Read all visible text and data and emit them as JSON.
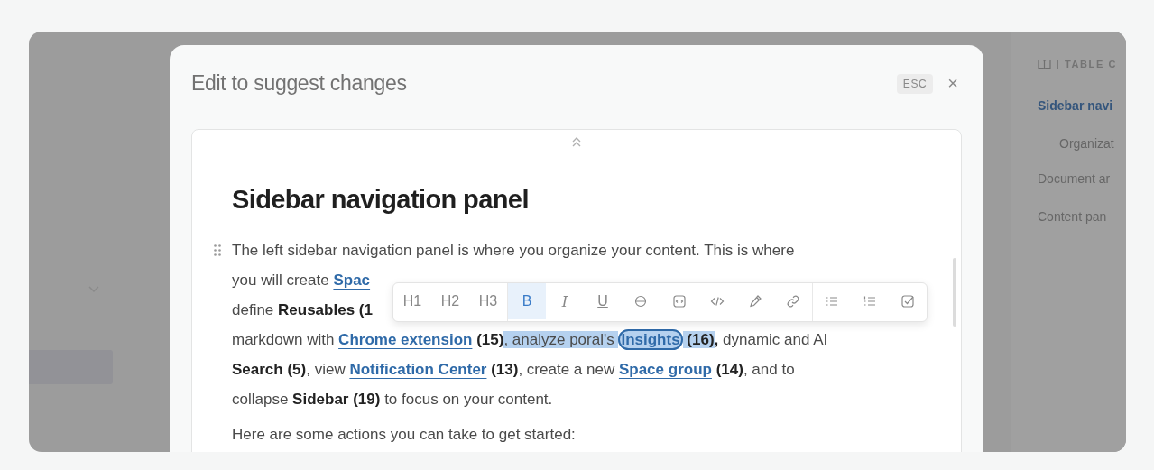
{
  "background_page": {
    "toc": {
      "heading": "TABLE C",
      "items": [
        {
          "label": "Sidebar navi",
          "selected": true,
          "children": [
            {
              "label": "Organizat",
              "selected": false
            }
          ]
        },
        {
          "label": "Document ar",
          "selected": false
        },
        {
          "label": "Content pan",
          "selected": false
        }
      ]
    }
  },
  "modal": {
    "title": "Edit to suggest changes",
    "shortcut": "ESC",
    "close": "×",
    "editor": {
      "heading": "Sidebar navigation panel",
      "paragraphs": [
        {
          "lines": [
            [
              {
                "kind": "text",
                "text": "The left sidebar navigation panel is where you organize your content. This is where",
                "selected": false
              }
            ],
            [
              {
                "kind": "text",
                "text": "you will create ",
                "selected": false
              },
              {
                "kind": "link",
                "text": "Spac",
                "selected": false
              }
            ],
            [
              {
                "kind": "text",
                "text": "define ",
                "selected": false
              },
              {
                "kind": "bold",
                "text": "Reusables (1",
                "selected": false
              }
            ],
            [
              {
                "kind": "text",
                "text": "markdown with ",
                "selected": false
              },
              {
                "kind": "link",
                "text": "Chrome extension",
                "selected": false
              },
              {
                "kind": "bold",
                "text": " (15)",
                "selected": false
              },
              {
                "kind": "text",
                "text": ", analyze poral's ",
                "selected": true
              },
              {
                "kind": "boxed-link",
                "text": "Insights",
                "selected": true
              },
              {
                "kind": "bold",
                "text": " (16)",
                "selected": true
              },
              {
                "kind": "bold",
                "text": ",",
                "selected": false
              },
              {
                "kind": "text",
                "text": " dynamic and AI",
                "selected": false
              }
            ],
            [
              {
                "kind": "bold",
                "text": "Search (5)",
                "selected": false
              },
              {
                "kind": "text",
                "text": ", view ",
                "selected": false
              },
              {
                "kind": "link",
                "text": "Notification Center",
                "selected": false
              },
              {
                "kind": "bold",
                "text": " (13)",
                "selected": false
              },
              {
                "kind": "text",
                "text": ", create a new ",
                "selected": false
              },
              {
                "kind": "link",
                "text": "Space group",
                "selected": false
              },
              {
                "kind": "bold",
                "text": " (14)",
                "selected": false
              },
              {
                "kind": "text",
                "text": ", and to",
                "selected": false
              }
            ],
            [
              {
                "kind": "text",
                "text": "collapse ",
                "selected": false
              },
              {
                "kind": "bold",
                "text": "Sidebar (19)",
                "selected": false
              },
              {
                "kind": "text",
                "text": " to focus on your content.",
                "selected": false
              }
            ]
          ]
        },
        {
          "lines": [
            [
              {
                "kind": "text",
                "text": "Here are some actions you can take to get started:",
                "selected": false
              }
            ]
          ]
        }
      ],
      "toolbar": {
        "groups": [
          [
            {
              "kind": "heading",
              "label": "H1",
              "selected": false
            },
            {
              "kind": "heading",
              "label": "H2",
              "selected": false
            },
            {
              "kind": "heading",
              "label": "H3",
              "selected": false
            }
          ],
          [
            {
              "kind": "bold",
              "label": "B",
              "selected": true
            },
            {
              "kind": "italic",
              "label": "I",
              "selected": false
            },
            {
              "kind": "underline",
              "label": "U",
              "selected": false
            },
            {
              "kind": "strike",
              "selected": false
            }
          ],
          [
            {
              "kind": "embed",
              "selected": false
            },
            {
              "kind": "code",
              "selected": false
            },
            {
              "kind": "pen",
              "selected": false
            },
            {
              "kind": "link",
              "selected": false
            }
          ],
          [
            {
              "kind": "bullets",
              "selected": false
            },
            {
              "kind": "numbered",
              "selected": false
            },
            {
              "kind": "task",
              "selected": false
            }
          ]
        ]
      }
    }
  }
}
